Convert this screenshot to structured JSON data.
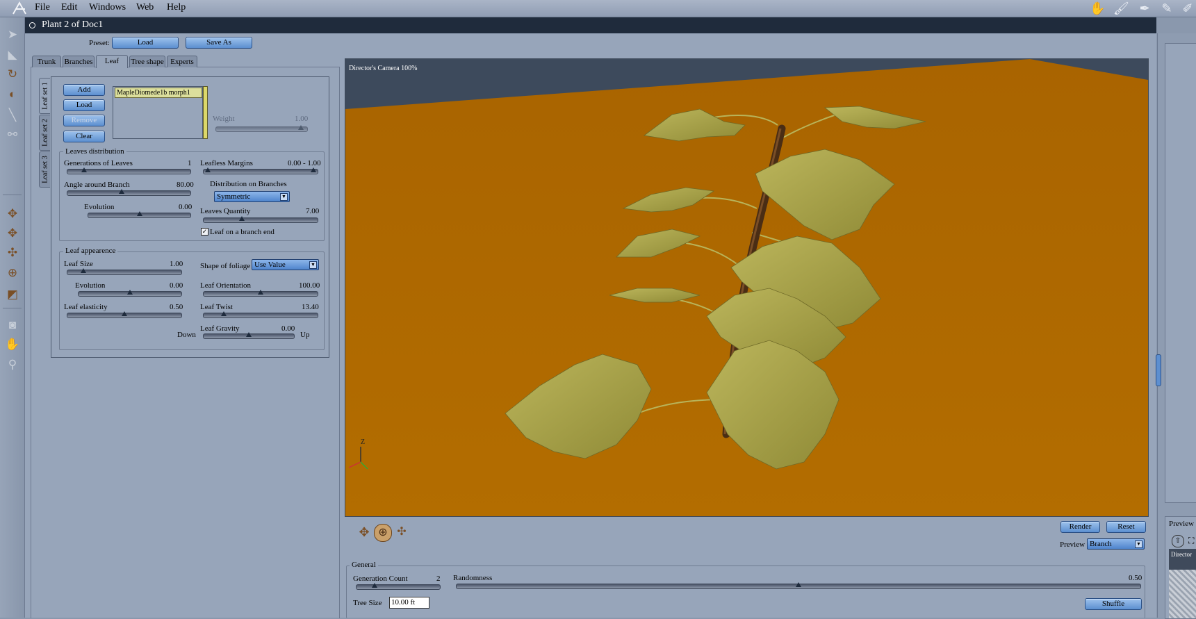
{
  "menu": {
    "items": [
      "File",
      "Edit",
      "Windows",
      "Web",
      "Help"
    ]
  },
  "topbar_icons": [
    "hand-icon",
    "brush-icon",
    "pen-icon",
    "pencil-icon",
    "edit-icon"
  ],
  "window": {
    "title": "Plant 2 of Doc1"
  },
  "preset": {
    "label": "Preset:",
    "load_label": "Load",
    "save_as_label": "Save As"
  },
  "tabs": [
    "Trunk",
    "Branches",
    "Leaf",
    "Tree shape",
    "Experts"
  ],
  "active_tab": "Leaf",
  "leaf_sets": [
    "Leaf set 1",
    "Leaf set 2",
    "Leaf set 3"
  ],
  "leaf_buttons": {
    "add": "Add",
    "load": "Load",
    "remove": "Remove",
    "clear": "Clear"
  },
  "leaf_list": {
    "items": [
      "MapleDiomede1b morph1"
    ]
  },
  "weight": {
    "label": "Weight",
    "value": "1.00"
  },
  "leaves_distribution": {
    "title": "Leaves distribution",
    "generations": {
      "label": "Generations of Leaves",
      "value": "1",
      "fraction": 0.12
    },
    "leafless_margins": {
      "label": "Leafless Margins",
      "value": "0.00 - 1.00"
    },
    "angle": {
      "label": "Angle around Branch",
      "value": "80.00",
      "fraction": 0.44
    },
    "distribution_label": "Distribution on Branches",
    "distribution_value": "Symmetric",
    "evolution": {
      "label": "Evolution",
      "value": "0.00",
      "fraction": 0.5
    },
    "quantity": {
      "label": "Leaves Quantity",
      "value": "7.00",
      "fraction": 0.33
    },
    "branch_end": {
      "label": "Leaf on a branch end",
      "checked": true
    }
  },
  "leaf_appearance": {
    "title": "Leaf appearence",
    "size": {
      "label": "Leaf Size",
      "value": "1.00",
      "fraction": 0.12
    },
    "shape_label": "Shape of foliage",
    "shape_value": "Use Value",
    "evolution": {
      "label": "Evolution",
      "value": "0.00",
      "fraction": 0.5
    },
    "orientation": {
      "label": "Leaf Orientation",
      "value": "100.00",
      "fraction": 0.5
    },
    "elasticity": {
      "label": "Leaf elasticity",
      "value": "0.50",
      "fraction": 0.5
    },
    "twist": {
      "label": "Leaf Twist",
      "value": "13.40",
      "fraction": 0.16
    },
    "gravity": {
      "label": "Leaf Gravity",
      "value": "0.00",
      "fraction": 0.5
    },
    "down_label": "Down",
    "up_label": "Up"
  },
  "viewport": {
    "camera_label": "Director's Camera 100%",
    "axis_z": "Z",
    "colors": {
      "ground": "#b36c00",
      "sky": "#3d4a5c",
      "leaf": "#a8a24a",
      "trunk": "#4a2d14"
    }
  },
  "view_controls": [
    "move-xy-icon",
    "rotate-icon",
    "move-xz-icon"
  ],
  "render": {
    "render_label": "Render",
    "reset_label": "Reset",
    "preview_label": "Preview",
    "preview_value": "Branch"
  },
  "general": {
    "title": "General",
    "generation_count": {
      "label": "Generation Count",
      "value": "2",
      "fraction": 0.2
    },
    "randomness": {
      "label": "Randomness",
      "value": "0.50",
      "fraction": 0.5
    },
    "tree_size_label": "Tree Size",
    "tree_size_value": "10.00 ft",
    "shuffle_label": "Shuffle"
  },
  "right_panel": {
    "preview_label": "Preview",
    "mini_label": "Director"
  }
}
